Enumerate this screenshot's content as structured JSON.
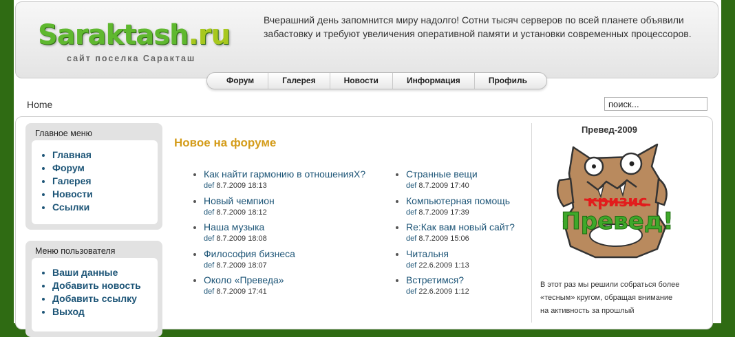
{
  "site": {
    "logo_main": "Saraktash",
    "logo_ext": ".ru",
    "tagline": "сайт поселка Саракташ",
    "header_text": "Вчерашний день запомнится миру надолго! Сотни тысяч серверов по всей планете объявили забастовку и требуют увеличения оперативной памяти и установки современных процессоров."
  },
  "nav": [
    "Форум",
    "Галерея",
    "Новости",
    "Информация",
    "Профиль"
  ],
  "breadcrumb": "Home",
  "search": {
    "value": "поиск..."
  },
  "main_menu": {
    "title": "Главное меню",
    "items": [
      "Главная",
      "Форум",
      "Галерея",
      "Новости",
      "Ссылки"
    ]
  },
  "user_menu": {
    "title": "Меню пользователя",
    "items": [
      "Ваши данные",
      "Добавить новость",
      "Добавить ссылку",
      "Выход"
    ]
  },
  "forum": {
    "title": "Новое на форуме",
    "left": [
      {
        "topic": "Как найти гармонию в отношенияХ?",
        "author": "def",
        "date": "8.7.2009 18:13"
      },
      {
        "topic": "Новый чемпион",
        "author": "def",
        "date": "8.7.2009 18:12"
      },
      {
        "topic": "Наша музыка",
        "author": "def",
        "date": "8.7.2009 18:08"
      },
      {
        "topic": "Философия бизнеса",
        "author": "def",
        "date": "8.7.2009 18:07"
      },
      {
        "topic": "Около «Преведа»",
        "author": "def",
        "date": "8.7.2009 17:41"
      }
    ],
    "right": [
      {
        "topic": "Странные вещи",
        "author": "def",
        "date": "8.7.2009 17:40"
      },
      {
        "topic": "Компьютерная помощь",
        "author": "def",
        "date": "8.7.2009 17:39"
      },
      {
        "topic": "Re:Как вам новый сайт?",
        "author": "def",
        "date": "8.7.2009 15:06"
      },
      {
        "topic": "Читальня",
        "author": "def",
        "date": "22.6.2009 1:13"
      },
      {
        "topic": "Встретимся?",
        "author": "def",
        "date": "22.6.2009 1:12"
      }
    ]
  },
  "promo": {
    "title": "Превед-2009",
    "image_word_crossed": "кризис",
    "image_word": "Превед!",
    "text": "В этот раз мы решили собраться более «тесным» кругом, обращая внимание на активность за прошлый"
  },
  "colors": {
    "background": "#2f6b13",
    "link": "#1d5577",
    "heading": "#d49c1a",
    "logo_green": "#5fb82f"
  }
}
